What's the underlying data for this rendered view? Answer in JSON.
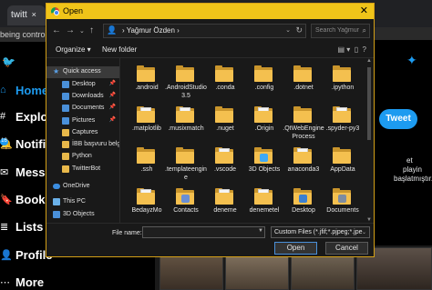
{
  "browser": {
    "tab_title": "twitt",
    "tab_close": "×",
    "notice": "being controlled"
  },
  "twitter": {
    "nav": [
      {
        "label": "Home",
        "icon": "home-icon",
        "glyph": "⌂"
      },
      {
        "label": "Explore",
        "icon": "hashtag-icon",
        "glyph": "#"
      },
      {
        "label": "Notifications",
        "icon": "bell-icon",
        "glyph": "🔔"
      },
      {
        "label": "Messages",
        "icon": "envelope-icon",
        "glyph": "✉"
      },
      {
        "label": "Bookmarks",
        "icon": "bookmark-icon",
        "glyph": "🔖"
      },
      {
        "label": "Lists",
        "icon": "list-icon",
        "glyph": "≣"
      },
      {
        "label": "Profile",
        "icon": "person-icon",
        "glyph": "👤"
      },
      {
        "label": "More",
        "icon": "more-icon",
        "glyph": "⋯"
      }
    ],
    "notification_badge": "16",
    "tweet_button": "Tweet",
    "sidebar_text": [
      "et",
      "playin",
      "başlatmıştır."
    ],
    "accent": "#1d9bf0"
  },
  "dialog": {
    "title": "Open",
    "close_glyph": "✕",
    "breadcrumb": "› Yağmur Özden ›",
    "search_placeholder": "Search Yağmur Özden",
    "commands": {
      "organize": "Organize ▾",
      "new_folder": "New folder"
    },
    "nav_pane": [
      {
        "label": "Quick access",
        "icon": "star-icon",
        "pinned": false
      },
      {
        "label": "Desktop",
        "icon": "desktop-folder-icon",
        "pinned": true
      },
      {
        "label": "Downloads",
        "icon": "downloads-folder-icon",
        "pinned": true
      },
      {
        "label": "Documents",
        "icon": "documents-folder-icon",
        "pinned": true
      },
      {
        "label": "Pictures",
        "icon": "pictures-folder-icon",
        "pinned": true
      },
      {
        "label": "Captures",
        "icon": "folder-icon",
        "pinned": false
      },
      {
        "label": "İBB başvuru belg",
        "icon": "folder-icon",
        "pinned": false
      },
      {
        "label": "Python",
        "icon": "folder-icon",
        "pinned": false
      },
      {
        "label": "TwitterBot",
        "icon": "folder-icon",
        "pinned": false
      },
      {
        "label": "OneDrive",
        "icon": "onedrive-icon",
        "pinned": false
      },
      {
        "label": "This PC",
        "icon": "computer-icon",
        "pinned": false
      },
      {
        "label": "3D Objects",
        "icon": "3d-objects-icon",
        "pinned": false
      }
    ],
    "files": [
      {
        "label": ".android",
        "icon": "folder-icon"
      },
      {
        "label": ".AndroidStudio3.5",
        "icon": "folder-icon"
      },
      {
        "label": ".conda",
        "icon": "folder-icon"
      },
      {
        "label": ".config",
        "icon": "folder-icon"
      },
      {
        "label": ".dotnet",
        "icon": "folder-icon"
      },
      {
        "label": ".ipython",
        "icon": "folder-icon"
      },
      {
        "label": ".matplotlib",
        "icon": "folder-doc-icon"
      },
      {
        "label": ".musixmatch",
        "icon": "folder-doc-icon"
      },
      {
        "label": ".nuget",
        "icon": "folder-icon"
      },
      {
        "label": ".Origin",
        "icon": "folder-doc-icon"
      },
      {
        "label": ".QtWebEngineProcess",
        "icon": "folder-icon"
      },
      {
        "label": ".spyder-py3",
        "icon": "folder-doc-icon"
      },
      {
        "label": ".ssh",
        "icon": "folder-icon"
      },
      {
        "label": ".templateengine",
        "icon": "folder-icon"
      },
      {
        "label": ".vscode",
        "icon": "folder-doc-icon"
      },
      {
        "label": "3D Objects",
        "icon": "3d-objects-folder-icon"
      },
      {
        "label": "anaconda3",
        "icon": "folder-doc-icon"
      },
      {
        "label": "AppData",
        "icon": "folder-icon"
      },
      {
        "label": "BedayzMo",
        "icon": "folder-doc-icon"
      },
      {
        "label": "Contacts",
        "icon": "contacts-folder-icon"
      },
      {
        "label": "deneme",
        "icon": "folder-doc-icon"
      },
      {
        "label": "denemetel",
        "icon": "folder-doc-icon"
      },
      {
        "label": "Desktop",
        "icon": "desktop-folder-icon"
      },
      {
        "label": "Documents",
        "icon": "documents-folder-icon"
      }
    ],
    "file_name_label": "File name:",
    "file_name_value": "",
    "file_type_filter": "Custom Files (*.jfif;*.pjpeg;*.jpe",
    "open_button": "Open",
    "cancel_button": "Cancel",
    "colors": {
      "title_bar": "#f0c419",
      "folder": "#f4c04f",
      "selected": "#3a3a3a"
    }
  }
}
